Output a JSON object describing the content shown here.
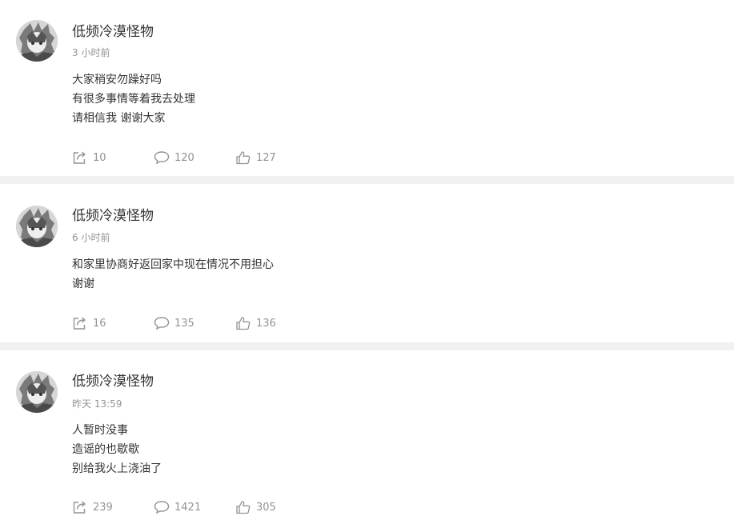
{
  "posts": [
    {
      "author": "低频冷漠怪物",
      "time": "3 小时前",
      "lines": [
        "大家稍安勿躁好吗",
        "有很多事情等着我去处理",
        "请相信我 谢谢大家"
      ],
      "reposts": "10",
      "comments": "120",
      "likes": "127"
    },
    {
      "author": "低频冷漠怪物",
      "time": "6 小时前",
      "lines": [
        "和家里协商好返回家中现在情况不用担心",
        "谢谢"
      ],
      "reposts": "16",
      "comments": "135",
      "likes": "136"
    },
    {
      "author": "低频冷漠怪物",
      "time": "昨天 13:59",
      "lines": [
        "人暂时没事",
        "造谣的也歇歇",
        "别给我火上浇油了"
      ],
      "reposts": "239",
      "comments": "1421",
      "likes": "305"
    }
  ],
  "icons": {
    "repost": "share-icon",
    "comment": "comment-bubble-icon",
    "like": "thumbs-up-icon",
    "avatar": "user-avatar"
  },
  "colors": {
    "text": "#333333",
    "meta": "#939393",
    "separator": "#f1f1f1"
  }
}
